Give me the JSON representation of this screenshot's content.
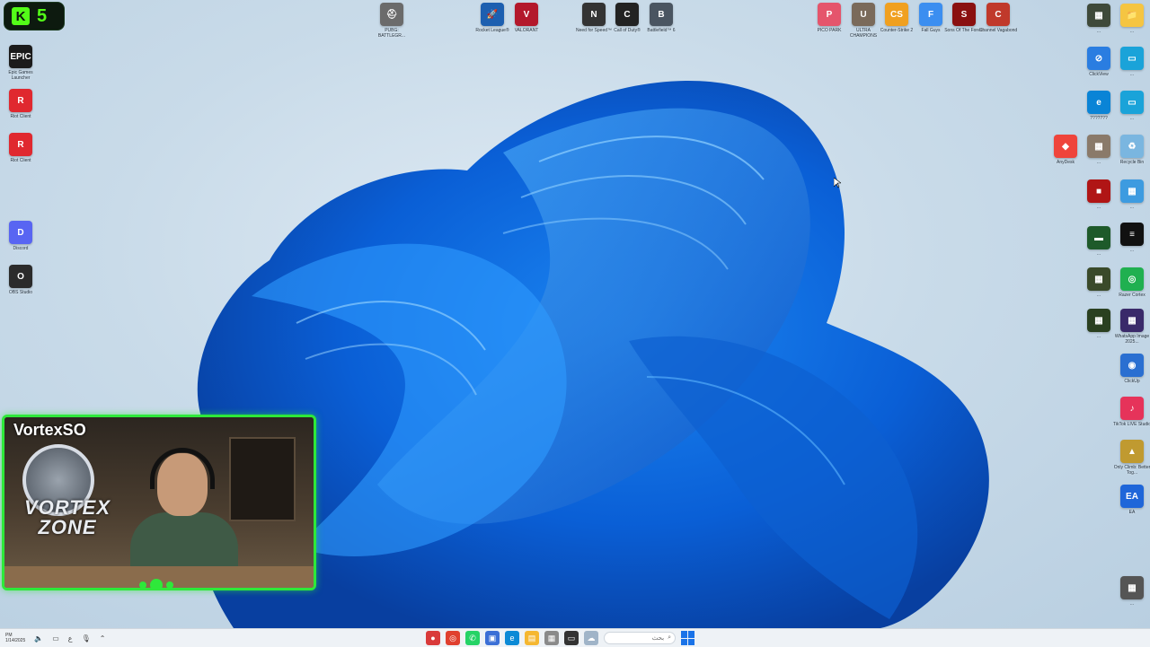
{
  "kick": {
    "count": "5",
    "icon": "kick-logo-icon",
    "color": "#53fc18"
  },
  "webcam": {
    "name": "VortexSO",
    "logo_text": "VORTEX ZONE",
    "frame_color": "#2ee83a"
  },
  "desktop_icons_top": [
    {
      "label": "PUBG: BATTLEGR...",
      "color": "#6b6b6b",
      "glyph": "⛑"
    },
    {
      "label": "Rocket League®",
      "color": "#1c5fb0",
      "glyph": "🚀"
    },
    {
      "label": "VALORANT",
      "color": "#b3182b",
      "glyph": "V"
    },
    {
      "label": "Need for Speed™",
      "color": "#333333",
      "glyph": "N"
    },
    {
      "label": "Call of Duty®",
      "color": "#222222",
      "glyph": "C"
    },
    {
      "label": "Battlefield™ 6",
      "color": "#4a5561",
      "glyph": "B"
    },
    {
      "label": "PICO PARK",
      "color": "#e5556c",
      "glyph": "P"
    },
    {
      "label": "ULTRA CHAMPIONS",
      "color": "#7a6a5a",
      "glyph": "U"
    },
    {
      "label": "Counter-Strike 2",
      "color": "#f0a020",
      "glyph": "CS"
    },
    {
      "label": "Fall Guys",
      "color": "#3b8ef0",
      "glyph": "F"
    },
    {
      "label": "Sons Of The Forest",
      "color": "#8a1010",
      "glyph": "S"
    },
    {
      "label": "Channel Vagabond",
      "color": "#c0392b",
      "glyph": "C"
    }
  ],
  "desktop_icons_left": [
    {
      "label": "Epic Games Launcher",
      "color": "#1b1b1b",
      "glyph": "EPIC"
    },
    {
      "label": "Riot Client",
      "color": "#e0282f",
      "glyph": "R"
    },
    {
      "label": "Riot Client",
      "color": "#e0282f",
      "glyph": "R"
    },
    {
      "label": "Discord",
      "color": "#5865f2",
      "glyph": "D"
    },
    {
      "label": "OBS Studio",
      "color": "#2b2b2b",
      "glyph": "O"
    }
  ],
  "desktop_icons_right_col1": [
    {
      "label": "...",
      "color": "#3f4a3a",
      "glyph": "▦"
    },
    {
      "label": "ClickView",
      "color": "#2a7de1",
      "glyph": "⊘"
    },
    {
      "label": "???????",
      "color": "#0a84d6",
      "glyph": "e"
    },
    {
      "label": "AnyDesk",
      "color": "#ef443b",
      "glyph": "◆"
    },
    {
      "label": "...",
      "color": "#8a7a6a",
      "glyph": "▦"
    },
    {
      "label": "...",
      "color": "#b01515",
      "glyph": "■"
    },
    {
      "label": "...",
      "color": "#1e5a2a",
      "glyph": "▬"
    },
    {
      "label": "...",
      "color": "#3a4a2a",
      "glyph": "▦"
    },
    {
      "label": "...",
      "color": "#2a4020",
      "glyph": "▦"
    }
  ],
  "desktop_icons_right_col2": [
    {
      "label": "...",
      "color": "#f5c542",
      "glyph": "📁"
    },
    {
      "label": "...",
      "color": "#1aa3d9",
      "glyph": "▭"
    },
    {
      "label": "...",
      "color": "#1aa3d9",
      "glyph": "▭"
    },
    {
      "label": "Recycle Bin",
      "color": "#7ab6e0",
      "glyph": "♻"
    },
    {
      "label": "...",
      "color": "#3d9be0",
      "glyph": "▦"
    },
    {
      "label": "...",
      "color": "#111111",
      "glyph": "≡"
    },
    {
      "label": "Razer Cortex",
      "color": "#20b050",
      "glyph": "◎"
    },
    {
      "label": "WhatsApp Image 2025...",
      "color": "#3a2a6a",
      "glyph": "▦"
    },
    {
      "label": "ClickUp",
      "color": "#2a6fd1",
      "glyph": "◉"
    },
    {
      "label": "TikTok LIVE Studio",
      "color": "#e6335a",
      "glyph": "♪"
    },
    {
      "label": "Only Climb: Better Tog...",
      "color": "#c09a30",
      "glyph": "▲"
    },
    {
      "label": "EA",
      "color": "#1f66d9",
      "glyph": "EA"
    },
    {
      "label": "...",
      "color": "#555555",
      "glyph": "▦"
    }
  ],
  "taskbar": {
    "clock_time": "PM",
    "clock_date": "1/14/2025",
    "search_placeholder": "بحث",
    "apps": [
      {
        "icon": "pinned-app-icon",
        "color": "#d93a3a",
        "glyph": "●"
      },
      {
        "icon": "chrome-icon",
        "color": "#e0402f",
        "glyph": "◎"
      },
      {
        "icon": "whatsapp-icon",
        "color": "#25d366",
        "glyph": "✆"
      },
      {
        "icon": "media-icon",
        "color": "#3b6fd6",
        "glyph": "▣"
      },
      {
        "icon": "edge-icon",
        "color": "#0c8ad6",
        "glyph": "e"
      },
      {
        "icon": "explorer-icon",
        "color": "#f5b731",
        "glyph": "▤"
      },
      {
        "icon": "gallery-icon",
        "color": "#8a8a8a",
        "glyph": "▦"
      },
      {
        "icon": "tv-icon",
        "color": "#333333",
        "glyph": "▭"
      },
      {
        "icon": "widgets-icon",
        "color": "#a0b4c8",
        "glyph": "☁"
      }
    ]
  }
}
